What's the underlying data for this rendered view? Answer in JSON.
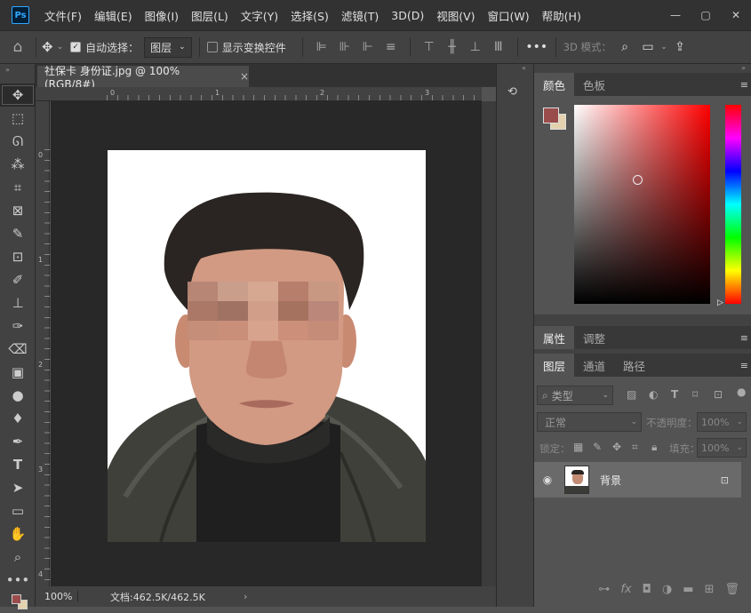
{
  "menubar": {
    "logo": "Ps",
    "items": [
      "文件(F)",
      "编辑(E)",
      "图像(I)",
      "图层(L)",
      "文字(Y)",
      "选择(S)",
      "滤镜(T)",
      "3D(D)",
      "视图(V)",
      "窗口(W)",
      "帮助(H)"
    ]
  },
  "options": {
    "auto_select_label": "自动选择：",
    "auto_select_value": "图层",
    "show_transform_label": "显示变换控件",
    "mode_3d_label": "3D 模式："
  },
  "document": {
    "tab_title": "社保卡 身份证.jpg @ 100%(RGB/8#)",
    "close": "×",
    "ruler_h": [
      "0",
      "1",
      "2",
      "3"
    ],
    "ruler_v": [
      "0",
      "1",
      "2",
      "3",
      "4"
    ]
  },
  "status": {
    "zoom": "100%",
    "doc_size": "文档:462.5K/462.5K",
    "arrow": "›"
  },
  "panels": {
    "color_tabs": [
      "颜色",
      "色板"
    ],
    "props_tabs": [
      "属性",
      "调整"
    ],
    "layer_tabs": [
      "图层",
      "通道",
      "路径"
    ],
    "filter_kind": "类型",
    "blend_mode": "正常",
    "opacity_label": "不透明度：",
    "opacity_value": "100%",
    "lock_label": "锁定：",
    "fill_label": "填充：",
    "fill_value": "100%",
    "layer_name": "背景"
  },
  "colors": {
    "foreground": "#9a4c4c",
    "background": "#e3d2ad",
    "picker_hue": "#ff0000"
  }
}
